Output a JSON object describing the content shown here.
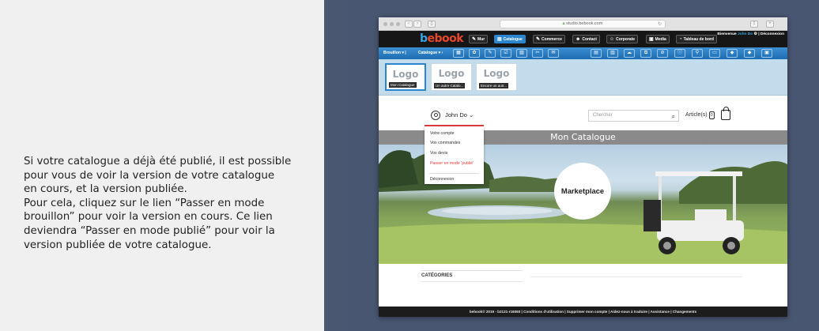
{
  "instructions": {
    "lines": [
      "Si votre catalogue a déjà été publié, il est possible",
      "pour vous de voir la version de votre catalogue",
      "en cours, et la version publiée.",
      "Pour cela, cliquez sur le lien “Passer en mode",
      "brouillon” pour voir la version en cours. Ce lien",
      "deviendra “Passer en mode publié” pour voir la",
      "version publiée de votre catalogue."
    ]
  },
  "browser": {
    "url": "studio.bebook.com",
    "reload_icon": "reload-icon"
  },
  "admin": {
    "logo": {
      "part1": "b",
      "part2": "ebook"
    },
    "nav": [
      {
        "label": "Mur",
        "icon": "edit-icon",
        "glyph": "✎"
      },
      {
        "label": "Catalogue",
        "icon": "catalog-icon",
        "glyph": "▤",
        "active": true
      },
      {
        "label": "Commerce",
        "icon": "commerce-icon",
        "glyph": "✎"
      },
      {
        "label": "Contact",
        "icon": "contacts-icon",
        "glyph": "☻"
      },
      {
        "label": "Corporate",
        "icon": "corporate-icon",
        "glyph": "☺"
      },
      {
        "label": "Media",
        "icon": "media-icon",
        "glyph": "▣"
      },
      {
        "label": "Tableau de bord",
        "icon": "dashboard-icon",
        "glyph": "◔"
      }
    ],
    "welcome": {
      "prefix": "Bienvenue",
      "user": "John Do",
      "logout": "Déconnexion"
    }
  },
  "toolbar": {
    "dropdown1": "Brouillon",
    "dropdown2": "Catalogue",
    "tools_left": [
      "▦",
      "✿",
      "✎",
      "☑",
      "▨",
      "✂",
      "✉"
    ],
    "tools_right": [
      "▤",
      "▥",
      "☁",
      "⧉",
      "⊘",
      "ⓘ",
      "⚲",
      "▭",
      "◆",
      "◆",
      "▣"
    ]
  },
  "logos": [
    {
      "text": "Logo",
      "caption": "Mon Catalogue",
      "selected": true
    },
    {
      "text": "Logo",
      "caption": "Un autre Catalo..."
    },
    {
      "text": "Logo",
      "caption": "Encore un autr..."
    }
  ],
  "site": {
    "account_name": "John Do",
    "search_placeholder": "Chercher",
    "cart_label": "Article(s)",
    "cart_count": "0",
    "banner_title": "Mon Catalogue",
    "marketplace": "Marketplace",
    "categories_label": "CATÉGORIES"
  },
  "account_menu": [
    {
      "label": "Votre compte"
    },
    {
      "label": "Vos commandes"
    },
    {
      "label": "Vos devis"
    },
    {
      "label": "Passer en mode 'publié'",
      "highlight": true
    },
    {
      "label": "Déconnexion"
    }
  ],
  "footer": {
    "text": "bebook© 2019 - b2121-r16060 | Conditions d'utilisation | Supprimer mon compte | Aidez-nous à traduire | Assistance | Changements"
  },
  "colors": {
    "accent_blue": "#2b86cf",
    "logo_orange": "#e8472a",
    "highlight_red": "#e53c3c",
    "admin_bar": "#161616",
    "outer_background": "#4a5770"
  }
}
